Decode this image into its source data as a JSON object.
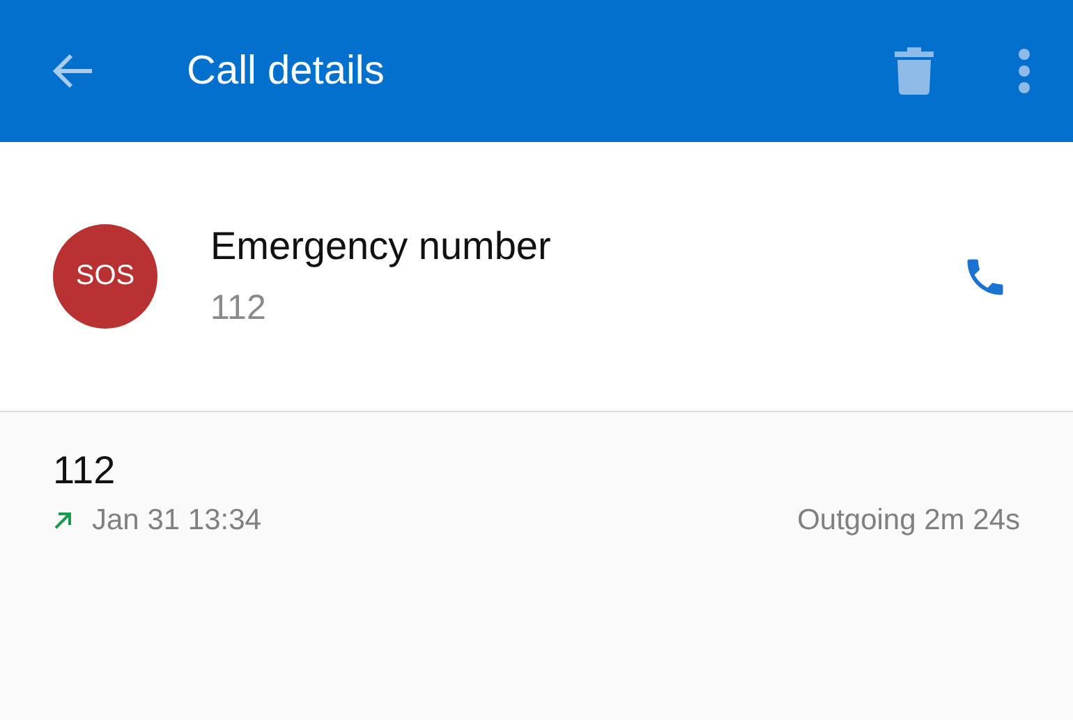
{
  "app_bar": {
    "title": "Call details"
  },
  "contact": {
    "avatar_text": "SOS",
    "name": "Emergency number",
    "number": "112"
  },
  "calls": [
    {
      "number": "112",
      "kind": "outgoing",
      "time": "Jan 31 13:34",
      "summary": "Outgoing 2m 24s"
    }
  ]
}
